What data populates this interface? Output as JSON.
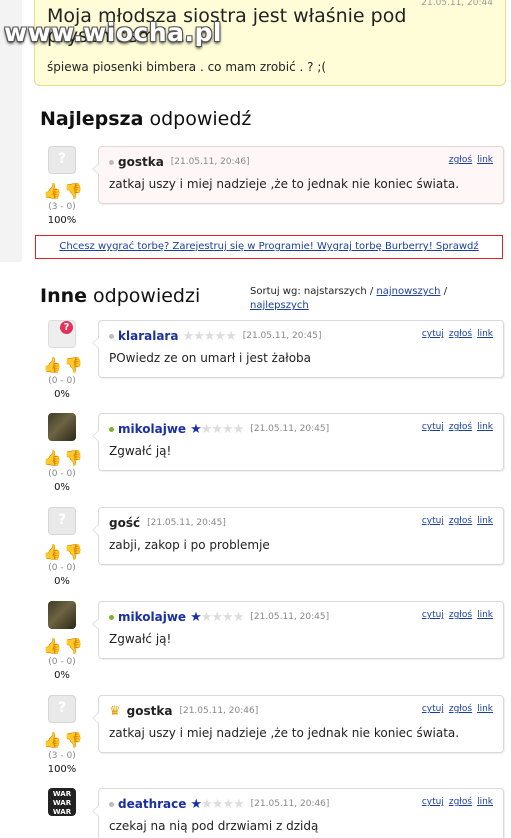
{
  "question": {
    "title": "Moja młodsza siostra jest właśnie pod prysznicem i ...",
    "description": "śpiewa piosenki bimbera . co mam zrobić . ? ;(",
    "date": "21.05.11, 20:44"
  },
  "watermark": "www.wiocha.pl",
  "best": {
    "heading_bold": "Najlepsza",
    "heading_rest": " odpowiedź",
    "user": "gostka",
    "date": "[21.05.11, 20:46]",
    "links": [
      "zgłoś",
      "link"
    ],
    "text": "zatkaj uszy i miej nadzieje ,że to jednak nie koniec świata.",
    "score": "(3 - 0)",
    "percent": "100%"
  },
  "promo": "Chcesz wygrać torbę? Zarejestruj się w Programie! Wygraj torbę Burberry! Sprawdź",
  "others": {
    "heading_bold": "Inne",
    "heading_rest": " odpowiedzi",
    "sort_label": "Sortuj wg: najstarszych / ",
    "sort_newest": "najnowszych",
    "sort_sep": " /",
    "sort_best": "najlepszych"
  },
  "answers": [
    {
      "user": "klaralara",
      "stars": 0,
      "date": "[21.05.11, 20:45]",
      "links": [
        "cytuj",
        "zgłoś",
        "link"
      ],
      "text": "POwiedz ze on umarł i jest żałoba",
      "score": "(0 - 0)",
      "percent": "0%",
      "avatar": "qmark",
      "online": false,
      "registered": true
    },
    {
      "user": "mikolajwe",
      "stars": 1,
      "date": "[21.05.11, 20:45]",
      "links": [
        "cytuj",
        "zgłoś",
        "link"
      ],
      "text": "Zgwałć ją!",
      "score": "(0 - 0)",
      "percent": "0%",
      "avatar": "forest",
      "online": true,
      "registered": true
    },
    {
      "user": "gość",
      "stars": -1,
      "date": "[21.05.11, 20:45]",
      "links": [
        "cytuj",
        "zgłoś",
        "link"
      ],
      "text": "zabji, zakop i po problemje",
      "score": "(0 - 0)",
      "percent": "0%",
      "avatar": "default",
      "online": false,
      "registered": false
    },
    {
      "user": "mikolajwe",
      "stars": 1,
      "date": "[21.05.11, 20:45]",
      "links": [
        "cytuj",
        "zgłoś",
        "link"
      ],
      "text": "Zgwałć ją!",
      "score": "(0 - 0)",
      "percent": "0%",
      "avatar": "forest",
      "online": true,
      "registered": true
    },
    {
      "user": "gostka",
      "stars": -1,
      "date": "[21.05.11, 20:46]",
      "links": [
        "cytuj",
        "zgłoś",
        "link"
      ],
      "text": "zatkaj uszy i miej nadzieje ,że to jednak nie koniec świata.",
      "score": "(3 - 0)",
      "percent": "100%",
      "avatar": "default",
      "online": false,
      "registered": true,
      "crown": true
    },
    {
      "user": "deathrace",
      "stars": 0.5,
      "date": "[21.05.11, 20:46]",
      "links": [
        "cytuj",
        "zgłoś",
        "link"
      ],
      "text": "czekaj na nią pod drzwiami z dzidą",
      "score": "",
      "percent": "",
      "avatar": "banner",
      "avatar_text": "WAR WAR WAR WAR",
      "online": false,
      "registered": true
    }
  ],
  "colors": {
    "link": "#1a3fa0",
    "username": "#1a2fa6",
    "question_bg": "#fffdd8",
    "promo_border": "#dd2222"
  },
  "icons": [
    "thumb-up-icon",
    "thumb-down-icon",
    "star-icon",
    "crown-icon",
    "status-dot-icon"
  ]
}
